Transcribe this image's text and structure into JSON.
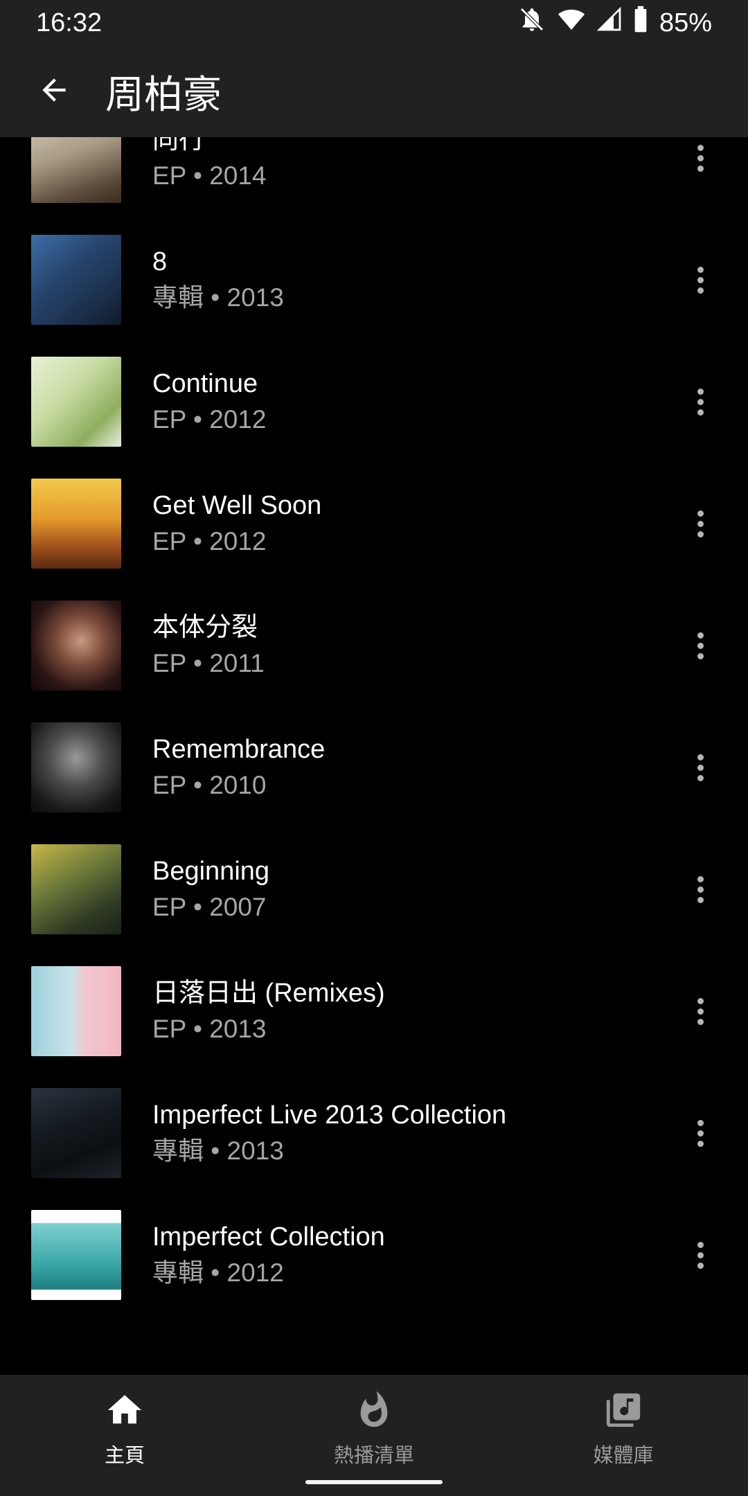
{
  "status_bar": {
    "time": "16:32",
    "battery_percent": "85%",
    "icons": [
      "bell-off-icon",
      "wifi-icon",
      "signal-icon",
      "battery-icon"
    ]
  },
  "header": {
    "title": "周柏豪",
    "back_icon": "arrow-back-icon"
  },
  "albums": [
    {
      "title": "同行",
      "subtitle": "EP • 2014"
    },
    {
      "title": "8",
      "subtitle": "專輯 • 2013"
    },
    {
      "title": "Continue",
      "subtitle": "EP • 2012"
    },
    {
      "title": "Get Well Soon",
      "subtitle": "EP • 2012"
    },
    {
      "title": "本体分裂",
      "subtitle": "EP • 2011"
    },
    {
      "title": "Remembrance",
      "subtitle": "EP • 2010"
    },
    {
      "title": "Beginning",
      "subtitle": "EP • 2007"
    },
    {
      "title": "日落日出 (Remixes)",
      "subtitle": "EP • 2013"
    },
    {
      "title": "Imperfect Live 2013 Collection",
      "subtitle": "專輯 • 2013"
    },
    {
      "title": "Imperfect Collection",
      "subtitle": "專輯 • 2012"
    }
  ],
  "bottom_nav": {
    "items": [
      {
        "label": "主頁",
        "icon": "home-icon",
        "active": true
      },
      {
        "label": "熱播清單",
        "icon": "fire-icon",
        "active": false
      },
      {
        "label": "媒體庫",
        "icon": "library-music-icon",
        "active": false
      }
    ]
  },
  "colors": {
    "background": "#000000",
    "bar_background": "#212121",
    "secondary_text": "#a6a6a6"
  }
}
